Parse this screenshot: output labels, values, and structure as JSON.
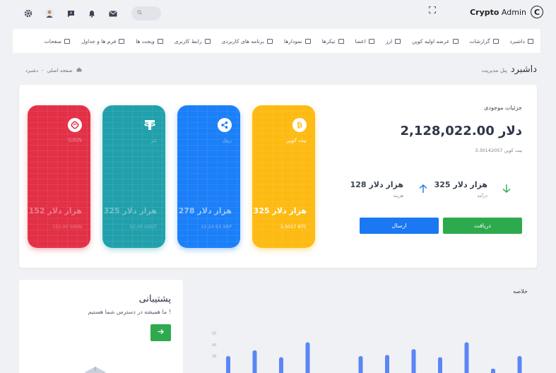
{
  "brand": {
    "name_bold": "Crypto",
    "name_rest": " Admin",
    "logo_letter": "C"
  },
  "topbar": {
    "search_placeholder": ""
  },
  "nav": {
    "items": [
      {
        "label": "داشبرد"
      },
      {
        "label": "گزارشات"
      },
      {
        "label": "عرضه اولیه کوین"
      },
      {
        "label": "ارز"
      },
      {
        "label": "اعضا"
      },
      {
        "label": "تیکرها"
      },
      {
        "label": "نمودارها"
      },
      {
        "label": "برنامه های کاربردی"
      },
      {
        "label": "رابط کاربری"
      },
      {
        "label": "ویجت ها"
      },
      {
        "label": "فرم ها و جداول"
      },
      {
        "label": "صفحات"
      }
    ]
  },
  "page": {
    "title": "داشبرد",
    "subtitle": "پنل مدیریت",
    "breadcrumb_home": "صفحه اصلی",
    "breadcrumb_sep": "-",
    "breadcrumb_current": "دشبرد"
  },
  "wallet": {
    "label": "جزئیات موجودی",
    "balance": "2,128,022.00 دلار",
    "balance_btc": "3.30142057 بیت کوین",
    "income_value": "325 هزار دلار",
    "income_label": "درآمد",
    "expense_value": "128 هزار دلار",
    "expense_label": "هزینه",
    "receive_label": "دریافت",
    "send_label": "ارسال",
    "colors": {
      "receive": "#2eaa4e",
      "send": "#1a78f2",
      "down_arrow": "#2eaa4e",
      "up_arrow": "#1a78f2"
    }
  },
  "coins": [
    {
      "name": "بیت کوین",
      "amount": "325 هزار دلار",
      "unit": "3.3017 BTC",
      "icon": "bitcoin-icon",
      "color": "#fdba12"
    },
    {
      "name": "ریپل",
      "amount": "278 هزار دلار",
      "unit": "13.24 63 XRP",
      "icon": "ripple-icon",
      "color": "#1b7ff8"
    },
    {
      "name": "تتر",
      "amount": "325 هزار دلار",
      "unit": "52.00 USDT",
      "icon": "tether-icon",
      "color": "#21a0ac"
    },
    {
      "name": "SIRIN",
      "amount": "152 هزار دلار",
      "unit": "152.00 SIRIN",
      "icon": "sirin-icon",
      "color": "#e23046"
    }
  ],
  "support": {
    "title": "پشتیبانی",
    "subtitle": "ما همیشه در دسترس شما هستیم !",
    "button_icon": "arrow-right-icon"
  },
  "summary": {
    "label": "خلاصه"
  },
  "chart_data": {
    "type": "bar",
    "yticks": [
      "50",
      "40",
      "30"
    ],
    "values": [
      30,
      35,
      29,
      42,
      14,
      30,
      31,
      36,
      29,
      42,
      19,
      30
    ],
    "ylim": [
      14,
      56
    ],
    "color": "#5b86f5"
  }
}
